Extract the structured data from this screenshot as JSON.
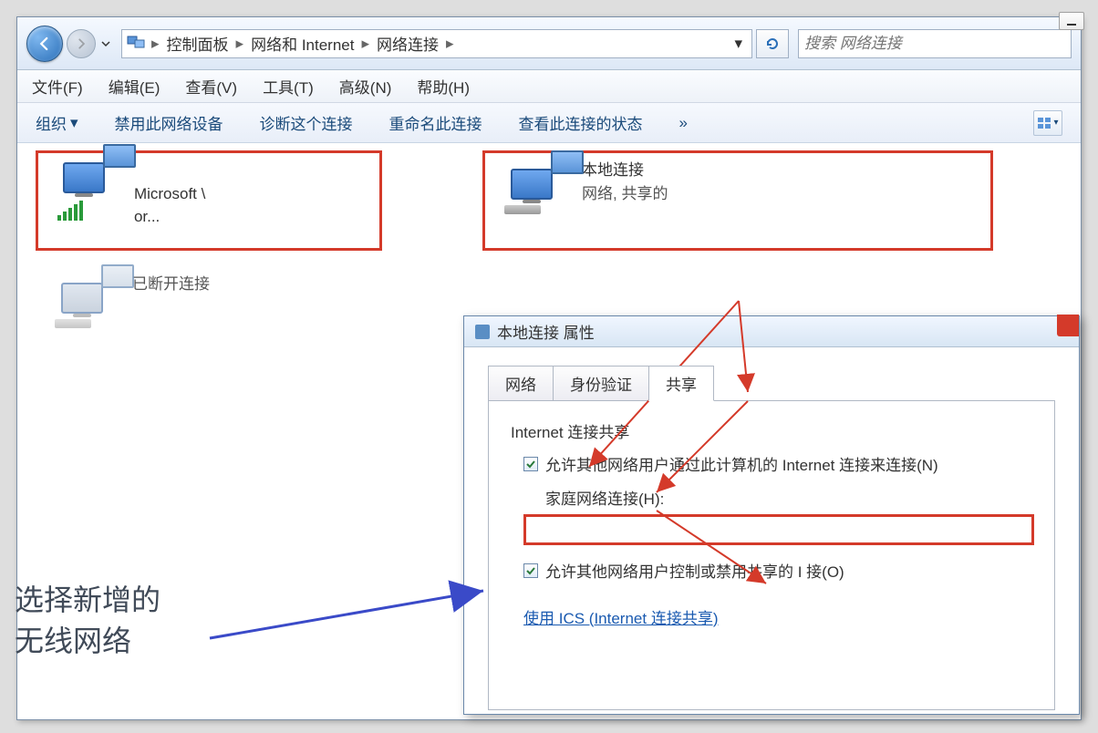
{
  "nav": {
    "breadcrumb": [
      "控制面板",
      "网络和 Internet",
      "网络连接"
    ],
    "search_placeholder": "搜索 网络连接"
  },
  "menu": {
    "file": "文件(F)",
    "edit": "编辑(E)",
    "view": "查看(V)",
    "tools": "工具(T)",
    "advanced": "高级(N)",
    "help": "帮助(H)"
  },
  "cmd": {
    "organize": "组织",
    "disable": "禁用此网络设备",
    "diagnose": "诊断这个连接",
    "rename": "重命名此连接",
    "status": "查看此连接的状态",
    "more": "»"
  },
  "connections": {
    "wifi": {
      "name_blur": "   ",
      "adapter": "Microsoft \\",
      "adapter_suffix": "or..."
    },
    "lan": {
      "name": "本地连接",
      "status": "网络, 共享的"
    },
    "disc": {
      "name_blur": " ",
      "status": "已断开连接"
    }
  },
  "dialog": {
    "title": "本地连接 属性",
    "tabs": {
      "network": "网络",
      "auth": "身份验证",
      "sharing": "共享"
    },
    "section": "Internet 连接共享",
    "chk1": "允许其他网络用户通过此计算机的 Internet 连接来连接(N)",
    "home_label": "家庭网络连接(H):",
    "combo_blur": " ",
    "chk2": "允许其他网络用户控制或禁用共享的 I 接(O)",
    "link": "使用 ICS (Internet 连接共享)"
  },
  "annotation": {
    "line1": "选择新增的",
    "line2": "无线网络"
  }
}
